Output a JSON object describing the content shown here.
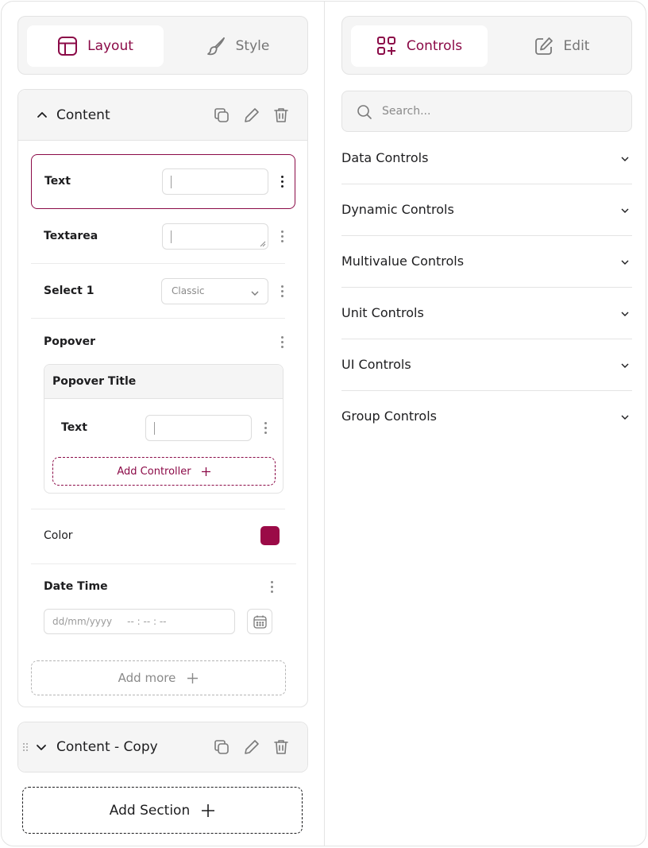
{
  "left_tabs": {
    "layout": "Layout",
    "style": "Style"
  },
  "right_tabs": {
    "controls": "Controls",
    "edit": "Edit"
  },
  "section_content": {
    "title": "Content",
    "text_row": {
      "label": "Text",
      "value": ""
    },
    "textarea_row": {
      "label": "Textarea",
      "value": ""
    },
    "select_row": {
      "label": "Select 1",
      "value": "Classic"
    },
    "popover_row": {
      "label": "Popover",
      "panel_title": "Popover Title",
      "inner_text_label": "Text",
      "add_controller": "Add Controller"
    },
    "color_row": {
      "label": "Color",
      "value": "#9b0a47"
    },
    "datetime_row": {
      "label": "Date Time",
      "placeholder": "dd/mm/yyyy     -- : -- : --"
    },
    "add_more": "Add more"
  },
  "section_copy": {
    "title": "Content - Copy"
  },
  "add_section": "Add Section",
  "search": {
    "placeholder": "Search..."
  },
  "accordion": [
    {
      "label": "Data Controls"
    },
    {
      "label": "Dynamic Controls"
    },
    {
      "label": "Multivalue Controls"
    },
    {
      "label": "Unit Controls"
    },
    {
      "label": "UI Controls"
    },
    {
      "label": "Group Controls"
    }
  ],
  "colors": {
    "accent": "#8b0a47",
    "panel_bg": "#f5f5f5",
    "border": "#e3e3e3"
  }
}
